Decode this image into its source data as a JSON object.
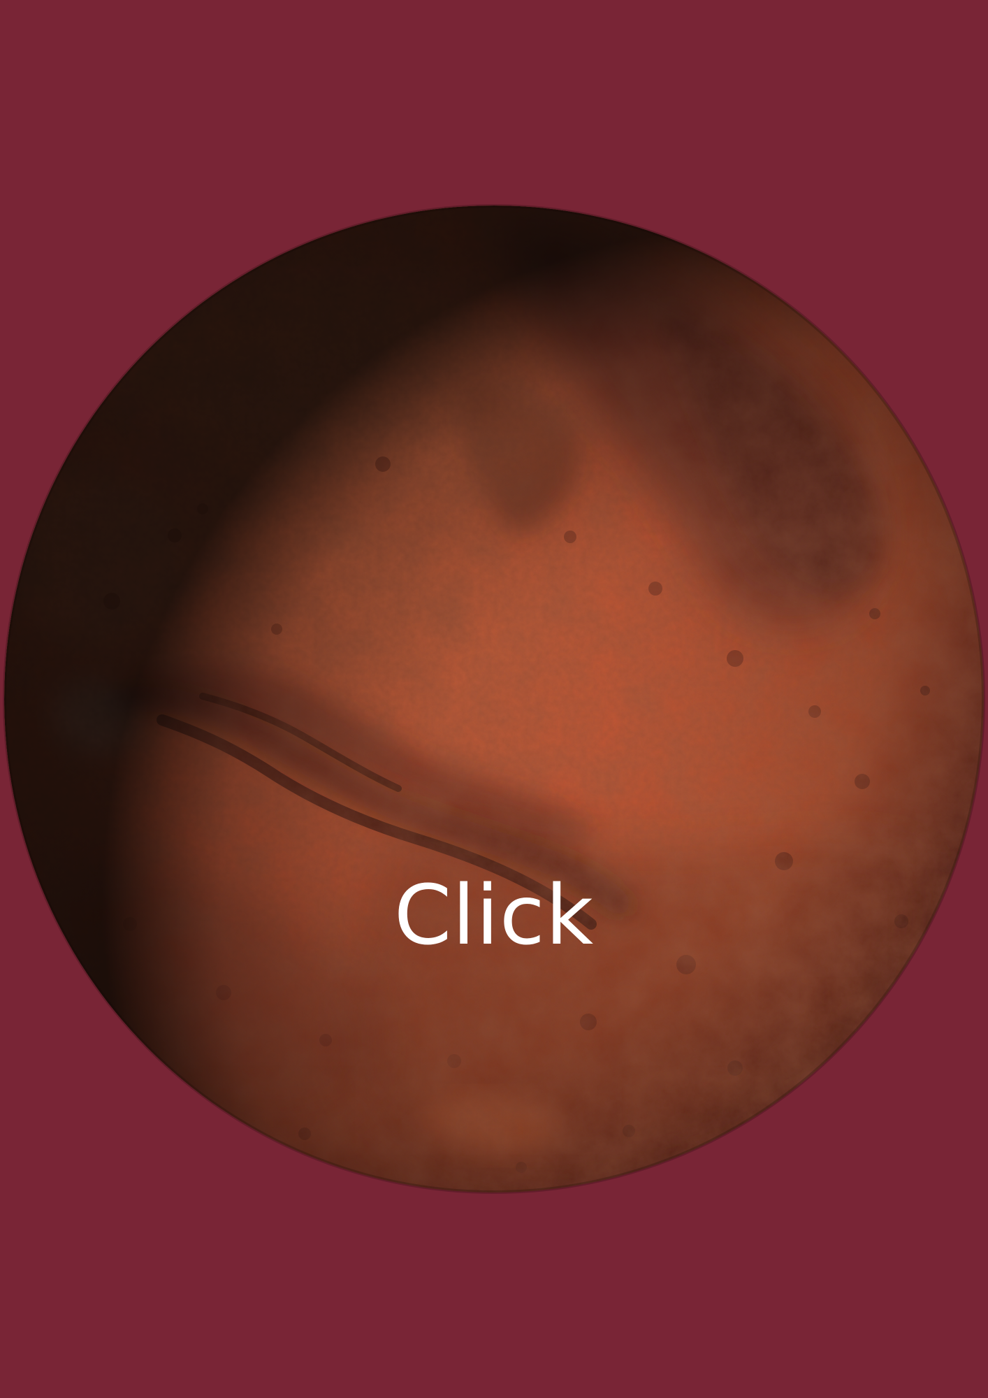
{
  "page": {
    "background_color": "#792536"
  },
  "planet": {
    "icon": "mars-planet-icon",
    "label": "Click",
    "colors": {
      "surface_light": "#e76a3f",
      "surface_mid": "#c9542f",
      "surface_dark": "#5b2a1f",
      "shadow": "#1a0907"
    }
  }
}
